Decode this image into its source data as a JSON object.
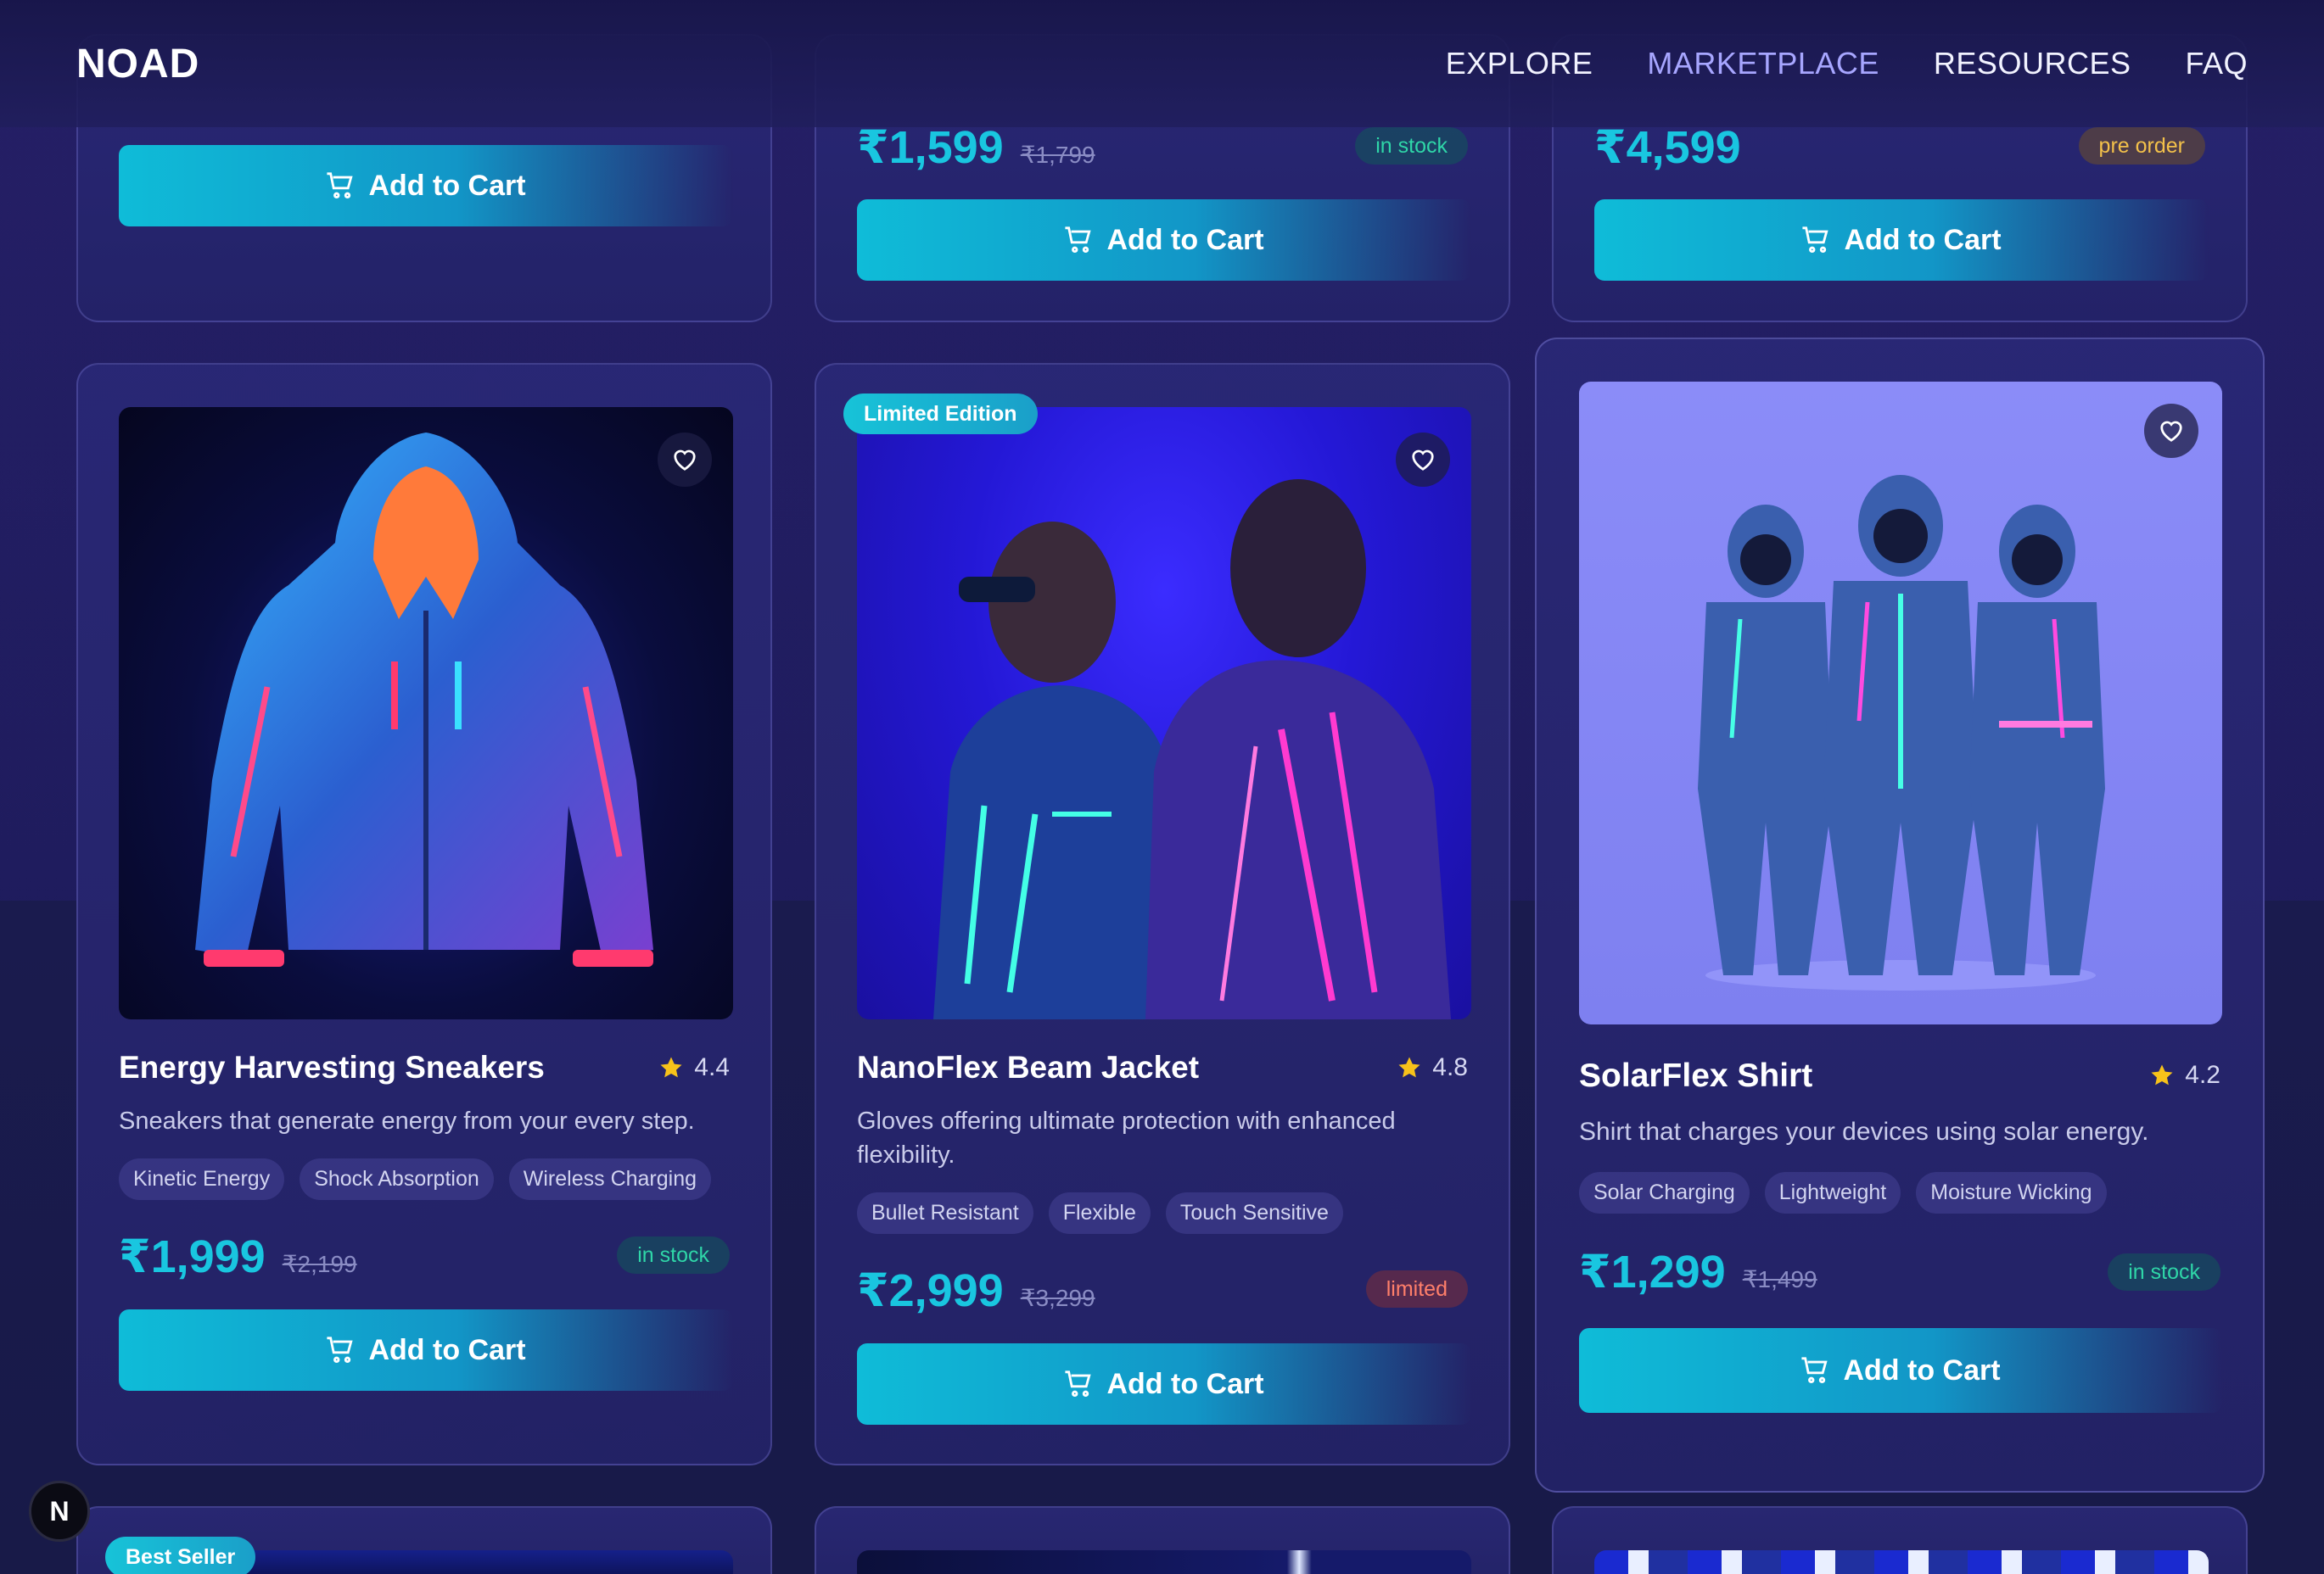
{
  "app": {
    "logo": "NOAD"
  },
  "nav": {
    "items": [
      {
        "label": "EXPLORE",
        "active": false
      },
      {
        "label": "MARKETPLACE",
        "active": true
      },
      {
        "label": "RESOURCES",
        "active": false
      },
      {
        "label": "FAQ",
        "active": false
      }
    ]
  },
  "top_row": [
    {
      "cart_label": "Add to Cart"
    },
    {
      "price": "₹1,599",
      "old_price": "₹1,799",
      "stock": "in stock",
      "cart_label": "Add to Cart"
    },
    {
      "price": "₹4,599",
      "stock": "pre order",
      "cart_label": "Add to Cart"
    }
  ],
  "products": [
    {
      "title": "Energy Harvesting Sneakers",
      "rating": "4.4",
      "description": "Sneakers that generate energy from your every step.",
      "tags": [
        "Kinetic Energy",
        "Shock Absorption",
        "Wireless Charging"
      ],
      "price": "₹1,999",
      "old_price": "₹2,199",
      "stock": "in stock",
      "cart_label": "Add to Cart",
      "image_icon": "glowing-jacket-image"
    },
    {
      "badge": "Limited Edition",
      "title": "NanoFlex Beam Jacket",
      "rating": "4.8",
      "description": "Gloves offering ultimate protection with enhanced flexibility.",
      "tags": [
        "Bullet Resistant",
        "Flexible",
        "Touch Sensitive"
      ],
      "price": "₹2,999",
      "old_price": "₹3,299",
      "stock": "limited",
      "cart_label": "Add to Cart",
      "image_icon": "two-people-neon-jackets-image"
    },
    {
      "title": "SolarFlex Shirt",
      "rating": "4.2",
      "description": "Shirt that charges your devices using solar energy.",
      "tags": [
        "Solar Charging",
        "Lightweight",
        "Moisture Wicking"
      ],
      "price": "₹1,299",
      "old_price": "₹1,499",
      "stock": "in stock",
      "cart_label": "Add to Cart",
      "image_icon": "three-suits-image"
    }
  ],
  "bottom_row": [
    {
      "badge": "Best Seller"
    }
  ],
  "dev_badge": {
    "label": "N"
  },
  "colors": {
    "accent": "#19c6e0",
    "nav_active": "#a7a6ff",
    "in_stock": "#2fd6a8",
    "pre_order": "#f3c14a",
    "limited": "#ff7f6a"
  }
}
